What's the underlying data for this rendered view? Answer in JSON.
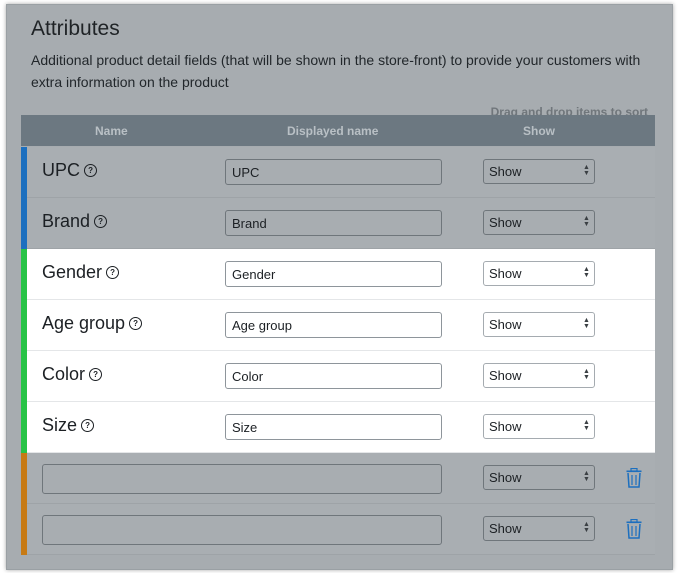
{
  "header": {
    "title": "Attributes",
    "description": "Additional product detail fields (that will be shown in the store-front) to provide your customers with extra information on the product",
    "sort_hint": "Drag and drop items to sort"
  },
  "table": {
    "columns": [
      "Name",
      "Displayed name",
      "Show"
    ],
    "rows": [
      {
        "name": "UPC",
        "displayed_name": "UPC",
        "show": "Show",
        "color": "#1c6fbf"
      },
      {
        "name": "Brand",
        "displayed_name": "Brand",
        "show": "Show",
        "color": "#1c6fbf"
      },
      {
        "name": "Gender",
        "displayed_name": "Gender",
        "show": "Show",
        "color": "#28c346"
      },
      {
        "name": "Age group",
        "displayed_name": "Age group",
        "show": "Show",
        "color": "#28c346"
      },
      {
        "name": "Color",
        "displayed_name": "Color",
        "show": "Show",
        "color": "#28c346"
      },
      {
        "name": "Size",
        "displayed_name": "Size",
        "show": "Show",
        "color": "#28c346"
      },
      {
        "name": "",
        "show": "Show",
        "color": "#c77a14"
      },
      {
        "name": "",
        "show": "Show",
        "color": "#c77a14"
      }
    ]
  },
  "icons": {
    "help": "help-circle-icon",
    "delete": "trash-icon",
    "select_arrows": "select-arrows-icon"
  }
}
